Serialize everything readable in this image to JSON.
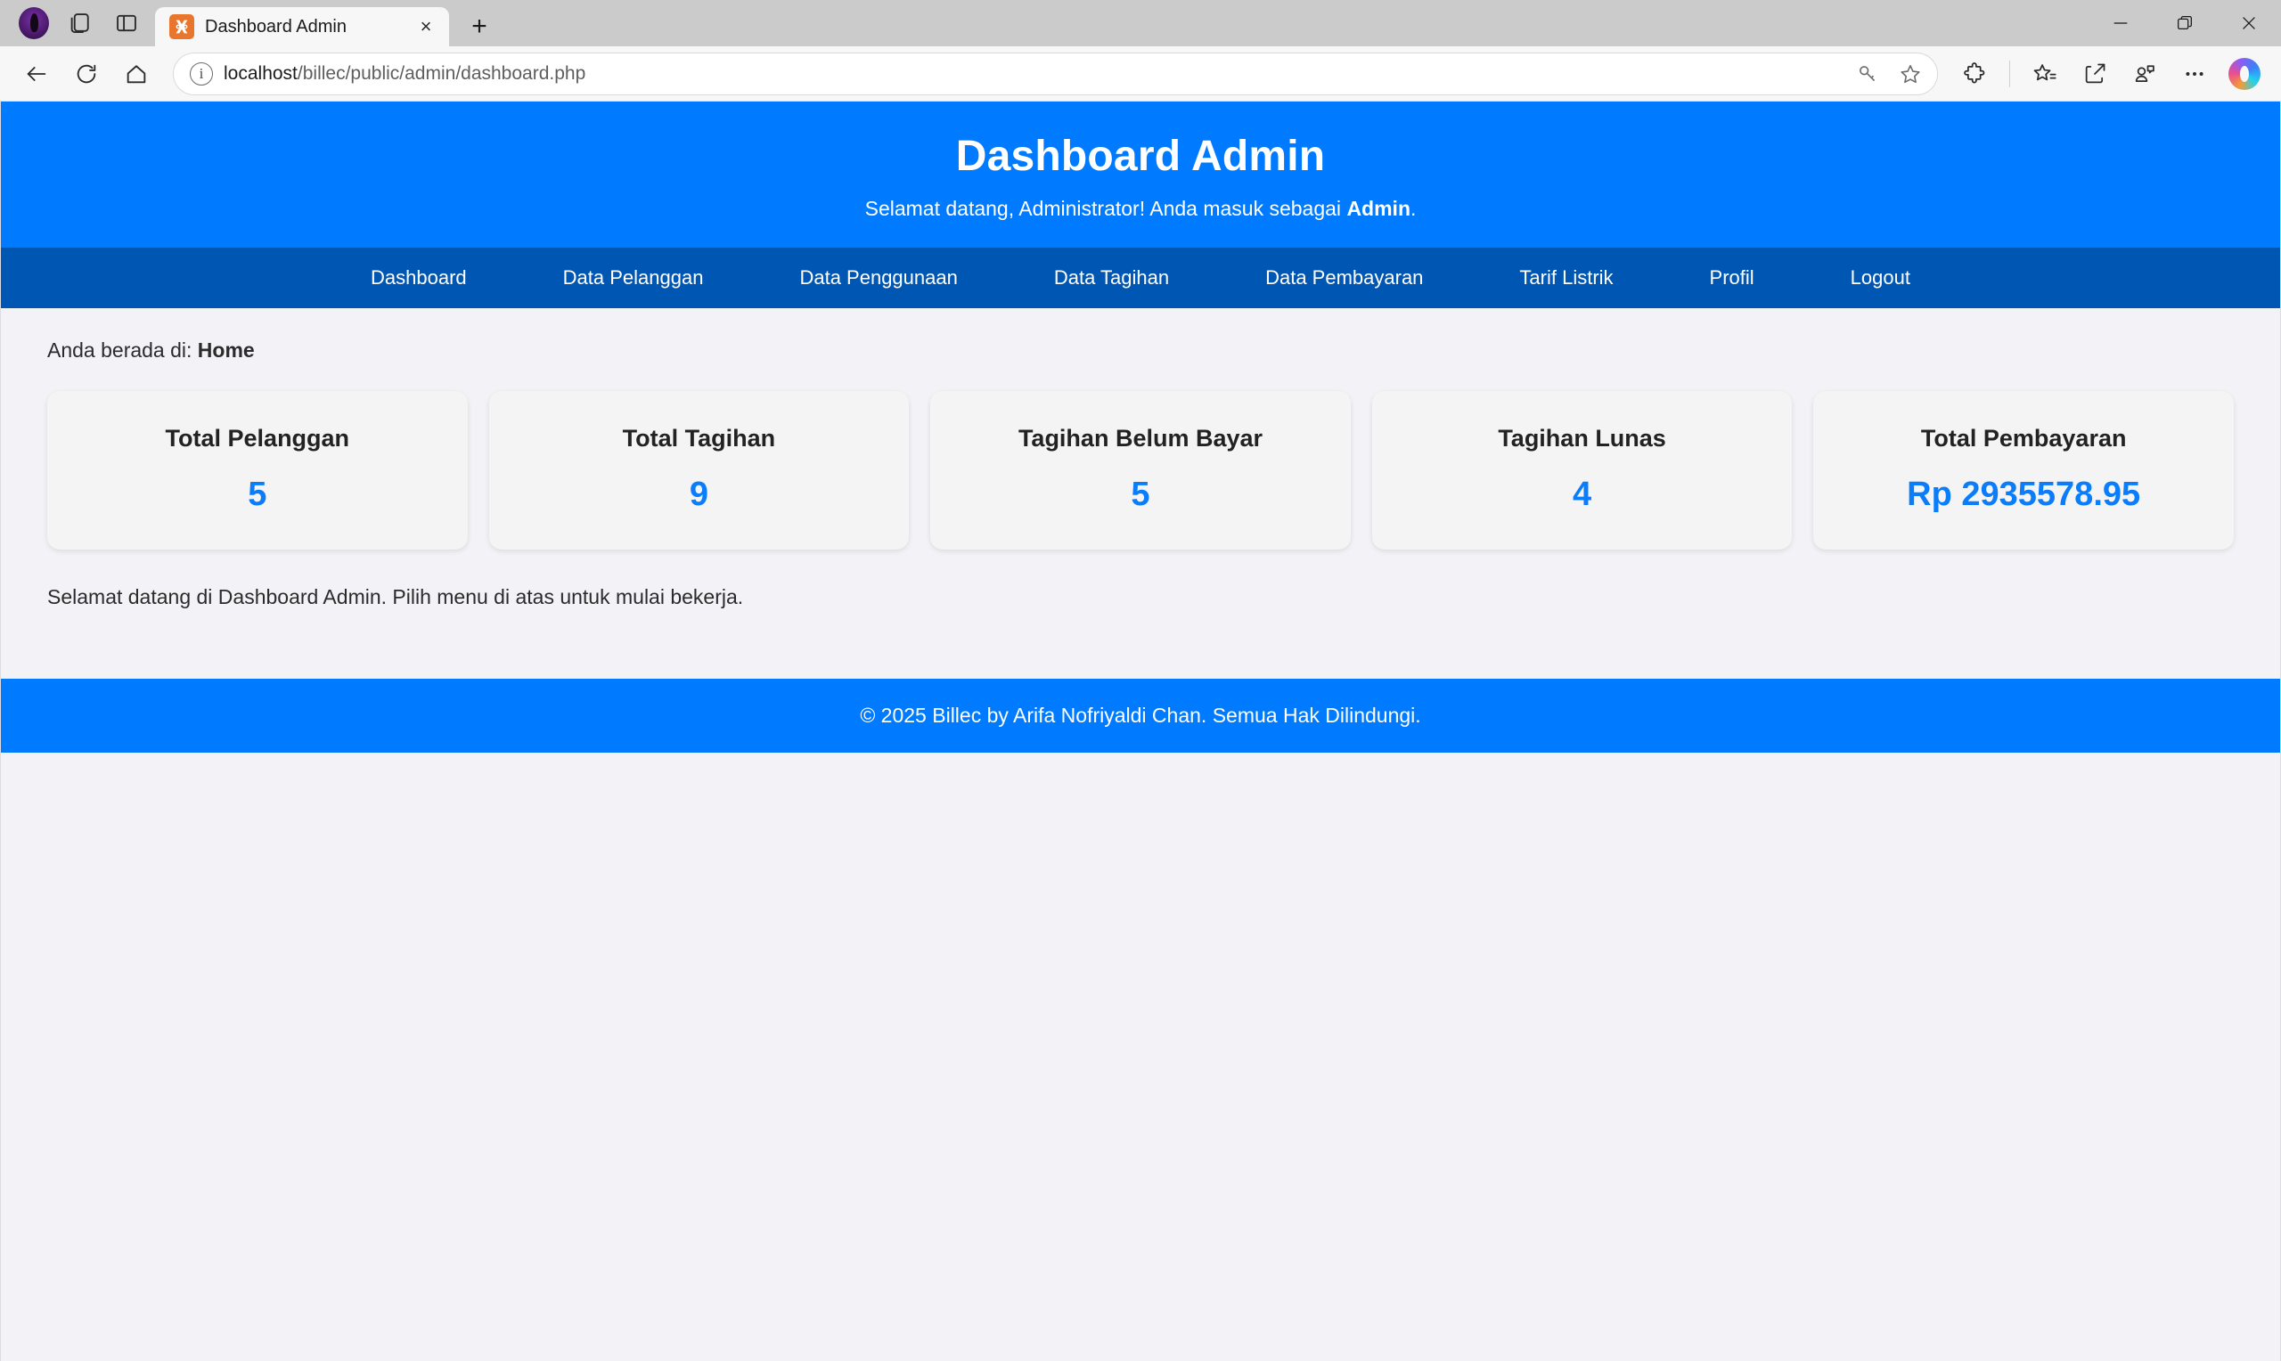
{
  "browser": {
    "tab": {
      "title": "Dashboard Admin",
      "favicon": "xampp-icon",
      "close": "×"
    },
    "new_tab_label": "+",
    "window_controls": {
      "minimize": "minimize-icon",
      "restore": "restore-icon",
      "close": "close-icon"
    },
    "toolbar": {
      "back": "back-arrow-icon",
      "reload": "reload-icon",
      "home": "home-icon",
      "site_info": "i",
      "url_host": "localhost",
      "url_path": "/billec/public/admin/dashboard.php",
      "url_full": "localhost/billec/public/admin/dashboard.php",
      "password_icon": "key-icon",
      "favorite_icon": "star-outline-icon",
      "extensions_icon": "puzzle-icon",
      "collections_icon": "favorites-list-icon",
      "share_icon": "share-icon",
      "split_screen_icon": "browser-essentials-icon",
      "settings_icon": "ellipsis-icon",
      "copilot_icon": "copilot-icon"
    }
  },
  "page": {
    "header": {
      "title": "Dashboard Admin",
      "greeting_prefix": "Selamat datang, Administrator! Anda masuk sebagai ",
      "greeting_role": "Admin",
      "greeting_suffix": "."
    },
    "nav": [
      {
        "label": "Dashboard"
      },
      {
        "label": "Data Pelanggan"
      },
      {
        "label": "Data Penggunaan"
      },
      {
        "label": "Data Tagihan"
      },
      {
        "label": "Data Pembayaran"
      },
      {
        "label": "Tarif Listrik"
      },
      {
        "label": "Profil"
      },
      {
        "label": "Logout"
      }
    ],
    "breadcrumb": {
      "prefix": "Anda berada di: ",
      "current": "Home"
    },
    "cards": [
      {
        "title": "Total Pelanggan",
        "value": "5"
      },
      {
        "title": "Total Tagihan",
        "value": "9"
      },
      {
        "title": "Tagihan Belum Bayar",
        "value": "5"
      },
      {
        "title": "Tagihan Lunas",
        "value": "4"
      },
      {
        "title": "Total Pembayaran",
        "value": "Rp 2935578.95"
      }
    ],
    "welcome_text": "Selamat datang di Dashboard Admin. Pilih menu di atas untuk mulai bekerja.",
    "footer": "© 2025 Billec by Arifa Nofriyaldi Chan. Semua Hak Dilindungi."
  },
  "colors": {
    "header_blue": "#007bff",
    "nav_blue": "#0056b3",
    "accent_value": "#0b7dfa",
    "page_bg": "#f3f3f7",
    "card_bg": "#f4f4f4"
  }
}
